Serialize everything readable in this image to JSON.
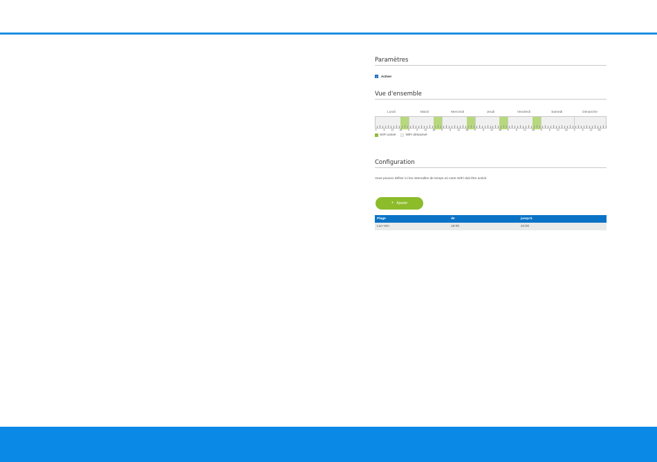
{
  "colors": {
    "accent_blue": "#1a8fe3",
    "footer_blue": "#0a8ae6",
    "table_header_blue": "#0b73c6",
    "wifi_active_green": "#b7d87c",
    "button_green": "#8cbc2a"
  },
  "settings": {
    "title": "Paramètres",
    "activate_label": "Activer",
    "activate_checked": true
  },
  "overview": {
    "title": "Vue d'ensemble",
    "days": [
      "Lundi",
      "Mardi",
      "Mercredi",
      "Jeudi",
      "Vendredi",
      "Samedi",
      "Dimanche"
    ],
    "hour_labels": [
      "0",
      "6",
      "12",
      "18"
    ],
    "active_blocks": [
      {
        "day": 0,
        "from_hour": 18,
        "to_hour": 24
      },
      {
        "day": 1,
        "from_hour": 18,
        "to_hour": 24
      },
      {
        "day": 2,
        "from_hour": 18,
        "to_hour": 24
      },
      {
        "day": 3,
        "from_hour": 18,
        "to_hour": 24
      },
      {
        "day": 4,
        "from_hour": 18,
        "to_hour": 24
      }
    ],
    "legend": {
      "active": "WiFi activé",
      "inactive": "WiFi désactivé"
    }
  },
  "configuration": {
    "title": "Configuration",
    "description": "Vous pouvez définir ici les intervalles de temps où votre WiFi doit être activé.",
    "add_button": {
      "icon": "plus-icon",
      "label": "Ajouter"
    },
    "table": {
      "headers": [
        "Plage",
        "de",
        "jusqu'à"
      ],
      "rows": [
        [
          "Lun-Ven",
          "18:00",
          "24:00"
        ]
      ]
    }
  }
}
